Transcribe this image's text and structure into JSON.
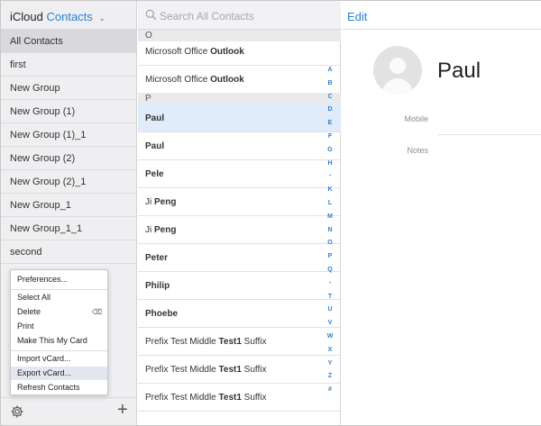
{
  "sidebar": {
    "brand": "iCloud",
    "app_name": "Contacts",
    "groups": [
      "All Contacts",
      "first",
      "New Group",
      "New Group (1)",
      "New Group (1)_1",
      "New Group (2)",
      "New Group (2)_1",
      "New Group_1",
      "New Group_1_1",
      "second"
    ],
    "selected_group": "All Contacts"
  },
  "menu": {
    "preferences": "Preferences...",
    "select_all": "Select All",
    "delete": "Delete",
    "print": "Print",
    "make_my_card": "Make This My Card",
    "import_vcard": "Import vCard...",
    "export_vcard": "Export vCard...",
    "refresh": "Refresh Contacts",
    "highlighted": "Export vCard..."
  },
  "search": {
    "placeholder": "Search All Contacts"
  },
  "contacts": {
    "sections": {
      "o": "O",
      "p": "P"
    },
    "rows": [
      {
        "first": "Microsoft Office ",
        "last": "Outlook"
      },
      {
        "first": "Microsoft Office ",
        "last": "Outlook"
      },
      {
        "first": "",
        "last": "Paul"
      },
      {
        "first": "",
        "last": "Paul"
      },
      {
        "first": "",
        "last": "Pele"
      },
      {
        "first": "Ji ",
        "last": "Peng"
      },
      {
        "first": "Ji ",
        "last": "Peng"
      },
      {
        "first": "",
        "last": "Peter"
      },
      {
        "first": "",
        "last": "Philip"
      },
      {
        "first": "",
        "last": "Phoebe"
      },
      {
        "first": "Prefix Test Middle ",
        "last": "Test1",
        "suffix": " Suffix"
      },
      {
        "first": "Prefix Test Middle ",
        "last": "Test1",
        "suffix": " Suffix"
      },
      {
        "first": "Prefix Test Middle ",
        "last": "Test1",
        "suffix": " Suffix"
      }
    ],
    "index": [
      "A",
      "B",
      "C",
      "D",
      "E",
      "F",
      "G",
      "H",
      "•",
      "K",
      "L",
      "M",
      "N",
      "O",
      "P",
      "Q",
      "•",
      "T",
      "U",
      "V",
      "W",
      "X",
      "Y",
      "Z",
      "#"
    ]
  },
  "detail": {
    "edit_label": "Edit",
    "name": "Paul",
    "mobile_label": "Mobile",
    "notes_label": "Notes"
  },
  "colors": {
    "accent": "#2a7fd4",
    "selection": "#e0ecf9",
    "sidebar_bg": "#efeff1"
  },
  "icons": [
    "gear-icon",
    "plus-icon",
    "search-icon",
    "chevron-down-icon",
    "person-placeholder-icon",
    "delete-key-icon"
  ]
}
